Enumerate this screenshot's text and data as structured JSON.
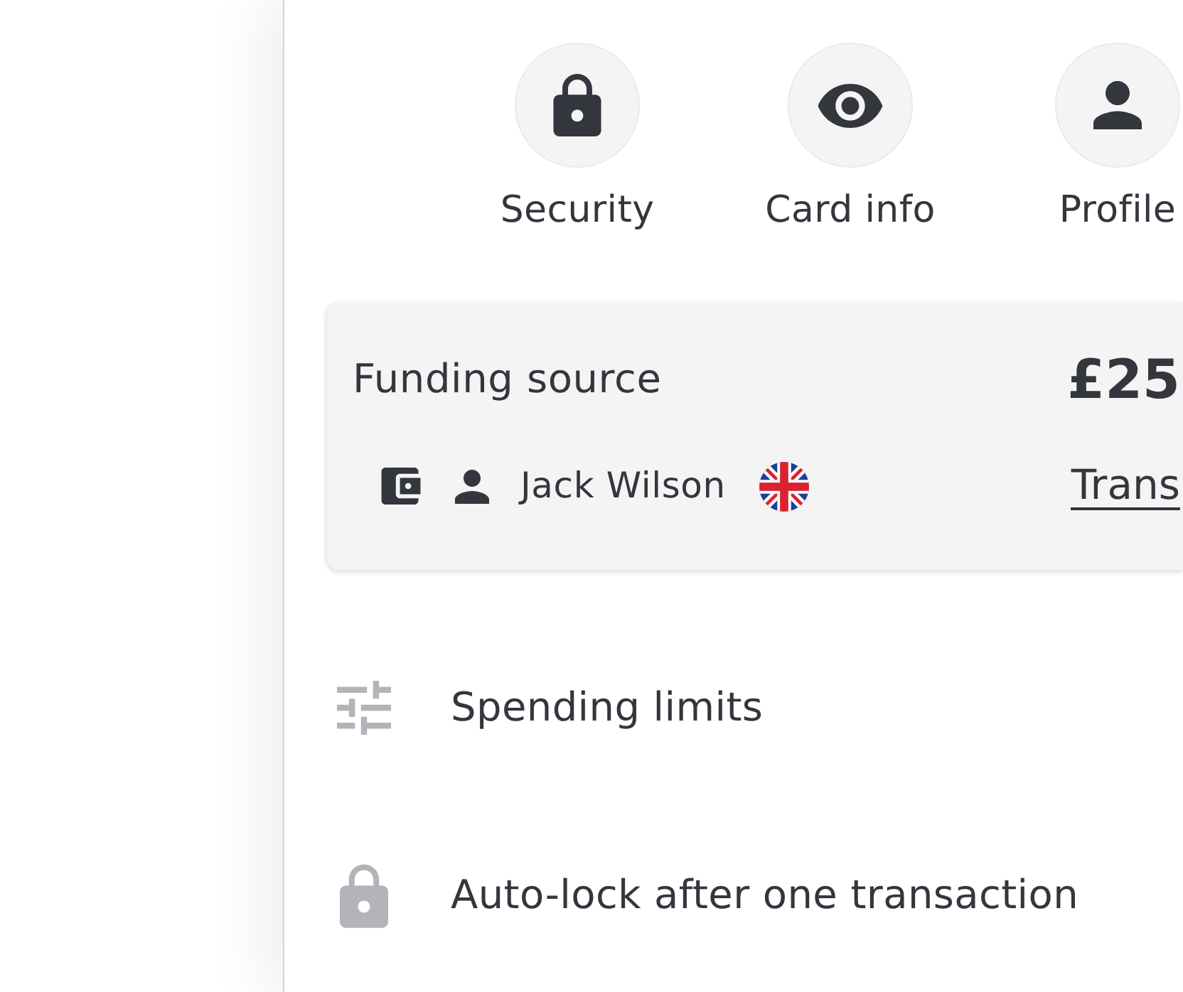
{
  "quick_actions": [
    {
      "label": "Security",
      "kind": "security"
    },
    {
      "label": "Card info",
      "kind": "card"
    },
    {
      "label": "Profile",
      "kind": "profile"
    }
  ],
  "funding_card": {
    "title": "Funding source",
    "amount": "£25",
    "owner": "Jack Wilson",
    "link": "Trans"
  },
  "settings": [
    {
      "label": "Spending limits",
      "kind": "limits"
    },
    {
      "label": "Auto-lock after one transaction",
      "kind": "autolock"
    }
  ]
}
